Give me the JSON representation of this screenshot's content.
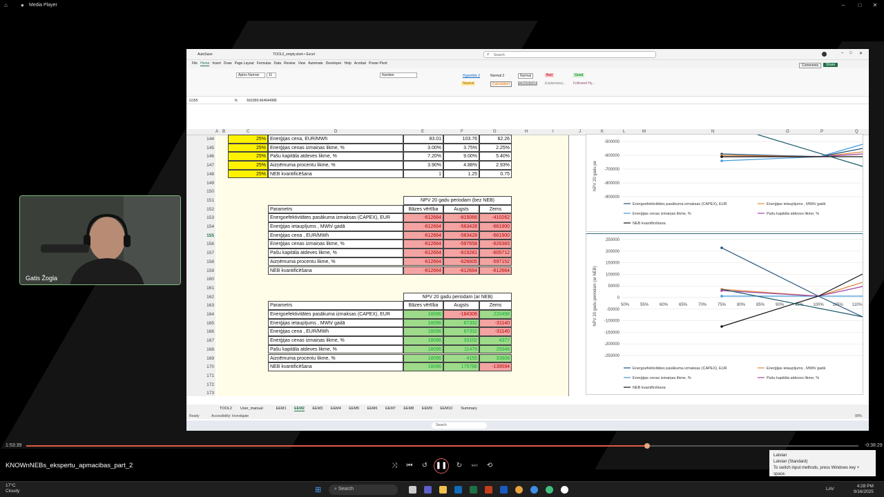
{
  "player": {
    "app_title": "Media Player",
    "time_current": "1:53:39",
    "time_total": "-0:38:29",
    "progress": 0.746,
    "video_title": "KNOWnNEBs_ekspertu_apmacibas_part_2"
  },
  "camera": {
    "person_name": "Gatis Žogla"
  },
  "excel": {
    "autosave": "AutoSave",
    "filename": "TOOL2_empty.xlsm • Excel",
    "search_placeholder": "Search",
    "comments": "Comments",
    "share": "Share",
    "menu": [
      "File",
      "Home",
      "Insert",
      "Draw",
      "Page Layout",
      "Formulas",
      "Data",
      "Review",
      "View",
      "Automate",
      "Developer",
      "Help",
      "Acrobat",
      "Power Pivot"
    ],
    "font_name": "Aptos Narrow",
    "font_size": "11",
    "number_format": "Number",
    "styles": [
      "Hyperlink 2",
      "Normal 2",
      "Normal",
      "Bad",
      "Good",
      "Neutral",
      "Calculation",
      "Check Cell",
      "Explanatory...",
      "Followed Hy..."
    ],
    "cell_ref": "G155",
    "formula": "-561899.664644986",
    "columns": [
      "A",
      "B",
      "C",
      "D",
      "E",
      "F",
      "G",
      "H",
      "I",
      "J",
      "K",
      "L",
      "M",
      "N",
      "O",
      "P",
      "Q"
    ],
    "rows": [
      {
        "n": "144",
        "pct": "25%",
        "label": "Enerģijas cena, EUR/MWh",
        "e": "83.01",
        "f": "103.76",
        "g": "62.26"
      },
      {
        "n": "145",
        "pct": "25%",
        "label": "Enerģijas cenas izmaiņas likme, %",
        "e": "3.00%",
        "f": "3.75%",
        "g": "2.25%"
      },
      {
        "n": "146",
        "pct": "25%",
        "label": "Pašu kapitāla atdeves likme, %",
        "e": "7.20%",
        "f": "9.00%",
        "g": "5.40%"
      },
      {
        "n": "147",
        "pct": "25%",
        "label": "Aizņēmuma procentu likme, %",
        "e": "3.90%",
        "f": "4.88%",
        "g": "2.93%"
      },
      {
        "n": "148",
        "pct": "25%",
        "label": "NEB kvantificēšana",
        "e": "1",
        "f": "1.25",
        "g": "0.75"
      }
    ],
    "row_numbers": [
      "144",
      "145",
      "146",
      "147",
      "148",
      "149",
      "150",
      "151",
      "152",
      "153",
      "154",
      "155",
      "156",
      "157",
      "158",
      "159",
      "160",
      "161",
      "162",
      "163",
      "164",
      "165",
      "166",
      "167",
      "168",
      "169",
      "170",
      "171",
      "172",
      "173"
    ],
    "table1": {
      "title": "NPV 20 gadu periodam (bez NEB)",
      "col_param": "Parametrs",
      "col_base": "Bāzes vērtība",
      "col_high": "Augsts",
      "col_low": "Zems",
      "rows": [
        {
          "p": "Energoefektivitātes pasākuma izmaksas (CAPEX), EUR",
          "b": "-612664",
          "h": "-815066",
          "l": "-410262"
        },
        {
          "p": "Enerģijas ietaupījums , MWh/ gadā",
          "b": "-612664",
          "h": "-563428",
          "l": "-661900"
        },
        {
          "p": "Enerģijas cena , EUR/MWh",
          "b": "-612664",
          "h": "-563428",
          "l": "-661900"
        },
        {
          "p": "Enerģijas cenas izmaiņas likme, %",
          "b": "-612664",
          "h": "-597658",
          "l": "-626383"
        },
        {
          "p": "Pašu kapitāla atdeves likme, %",
          "b": "-612664",
          "h": "-619281",
          "l": "-605712"
        },
        {
          "p": "Aizņēmuma procentu likme, %",
          "b": "-612664",
          "h": "-626605",
          "l": "-597152"
        },
        {
          "p": "NEB kvantificēšana",
          "b": "-612664",
          "h": "-612664",
          "l": "-612664"
        }
      ]
    },
    "table2": {
      "title": "NPV 20 gadu periodam (ar NEB)",
      "col_param": "Parametrs",
      "col_base": "Bāzes vērtība",
      "col_high": "Augsts",
      "col_low": "Zems",
      "rows": [
        {
          "p": "Energoefektivitātes pasākuma izmaksas (CAPEX), EUR",
          "b": "18096",
          "h": "-184306",
          "l": "220498"
        },
        {
          "p": "Enerģijas ietaupījums , MWh/ gadā",
          "b": "18096",
          "h": "67332",
          "l": "-31140"
        },
        {
          "p": "Enerģijas cena , EUR/MWh",
          "b": "18096",
          "h": "67332",
          "l": "-31140"
        },
        {
          "p": "Enerģijas cenas izmaiņas likme, %",
          "b": "18096",
          "h": "33102",
          "l": "4377"
        },
        {
          "p": "Pašu kapitāla atdeves likme, %",
          "b": "18096",
          "h": "11479",
          "l": "25048"
        },
        {
          "p": "Aizņēmuma procentu likme, %",
          "b": "18096",
          "h": "4155",
          "l": "33608"
        },
        {
          "p": "NEB kvantificēšana",
          "b": "18096",
          "h": "175786",
          "l": "-139594"
        }
      ]
    },
    "chart1": {
      "ylabel": "NPV 20 gadu pe",
      "yticks": [
        "-500000",
        "-600000",
        "-700000",
        "-800000",
        "-900000"
      ],
      "legend": [
        "Energoefektivitātes pasākuma izmaksas (CAPEX), EUR",
        "Enerģijas ietaupījums , MWh/ gadā",
        "Enerģijas cenas izmaiņas likme, %",
        "Pašu kapitāla atdeves likme, %",
        "NEB kvantificēšana"
      ]
    },
    "chart2": {
      "ylabel": "NPV 20 gadu periodam (ar NEB)",
      "yticks": [
        "250000",
        "200000",
        "150000",
        "100000",
        "50000",
        "0",
        "-50000",
        "-100000",
        "-150000",
        "-200000",
        "-250000"
      ],
      "xticks": [
        "50%",
        "55%",
        "60%",
        "65%",
        "70%",
        "75%",
        "80%",
        "85%",
        "90%",
        "95%",
        "100%",
        "105%",
        "110%"
      ],
      "legend": [
        "Energoefektivitātes pasākuma izmaksas (CAPEX), EUR",
        "Enerģijas ietaupījums , MWh/ gadā",
        "Enerģijas cenas izmaiņas likme, %",
        "Pašu kapitāla atdeves likme, %",
        "NEB kvantificēšana"
      ]
    },
    "sheet_tabs": [
      "TOOL2",
      "User_manual",
      "EEM1",
      "EEM2",
      "EEM3",
      "EEM4",
      "EEM5",
      "EEM6",
      "EEM7",
      "EEM8",
      "EEM9",
      "EEM10",
      "Summary"
    ],
    "active_tab": "EEM2",
    "status_ready": "Ready",
    "status_access": "Accessibility: Investigate",
    "zoom": "90%"
  },
  "language_popup": {
    "line1": "Latvian",
    "line2": "Latvian (Standard)",
    "line3": "To switch input methods, press Windows key + space."
  },
  "taskbar": {
    "temp": "17°C",
    "weather": "Cloudy",
    "search": "Search",
    "lang": "LAV",
    "time": "4:28 PM",
    "date": "9/16/2025"
  },
  "colors": {
    "accent_red": "#e15b47",
    "sheet_yellow": "#fff200",
    "cell_red": "#f4a3a3",
    "cell_green": "#9ddb8a"
  }
}
